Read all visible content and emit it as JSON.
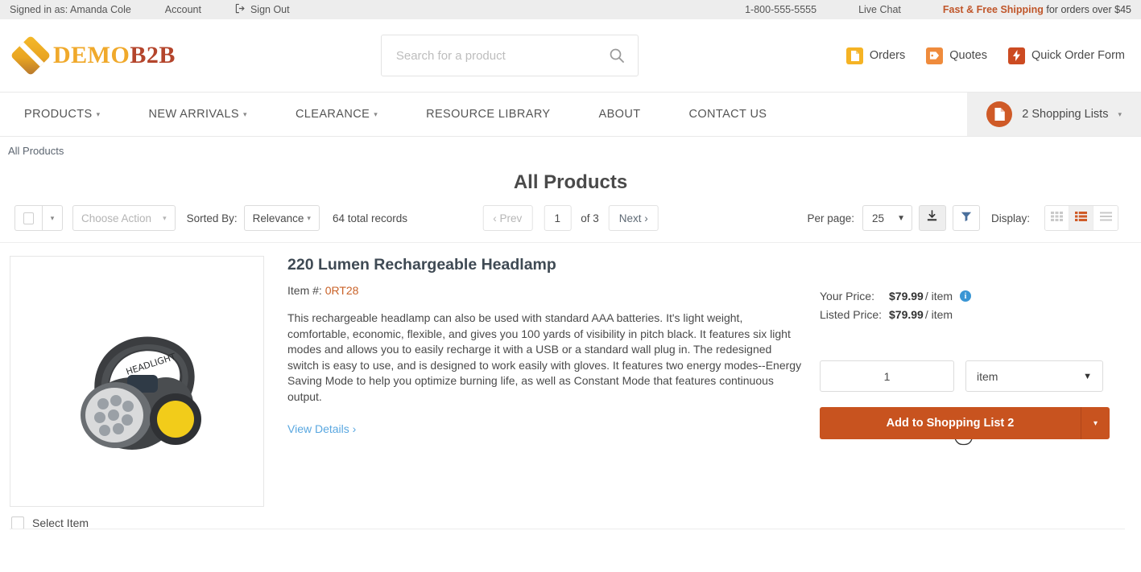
{
  "utility": {
    "signed_in": "Signed in as: Amanda Cole",
    "account": "Account",
    "sign_out": "Sign Out",
    "sign_out_icon": "sign-out-icon",
    "phone": "1-800-555-5555",
    "live_chat": "Live Chat",
    "shipping_highlight": "Fast & Free Shipping",
    "shipping_rest": " for orders over $45"
  },
  "header": {
    "logo_part1": "DEMO",
    "logo_part2": "B2B",
    "search_placeholder": "Search for a product",
    "search_value": "",
    "search_icon": "search-icon",
    "actions": [
      {
        "label": "Orders",
        "icon": "orders-document-icon",
        "color": "#f5b324"
      },
      {
        "label": "Quotes",
        "icon": "quotes-tag-icon",
        "color": "#ef8b3c"
      },
      {
        "label": "Quick Order Form",
        "icon": "lightning-bolt-icon",
        "color": "#cc4b22"
      }
    ]
  },
  "nav": {
    "items": [
      {
        "label": "PRODUCTS",
        "has_caret": true
      },
      {
        "label": "NEW ARRIVALS",
        "has_caret": true
      },
      {
        "label": "CLEARANCE",
        "has_caret": true
      },
      {
        "label": "RESOURCE LIBRARY",
        "has_caret": false
      },
      {
        "label": "ABOUT",
        "has_caret": false
      },
      {
        "label": "CONTACT US",
        "has_caret": false
      }
    ],
    "shopping_lists_label": "2 Shopping Lists",
    "shopping_lists_icon": "shopping-list-document-icon"
  },
  "breadcrumb": "All Products",
  "page_title": "All Products",
  "toolbar": {
    "select_all_caret": "▾",
    "choose_action": "Choose Action",
    "choose_action_caret": "▾",
    "sorted_by_label": "Sorted By:",
    "sort_value": "Relevance",
    "sort_caret": "▾",
    "total_records": "64 total records",
    "prev": "‹ Prev",
    "page_number": "1",
    "of_pages": "of 3",
    "next": "Next ›",
    "per_page_label": "Per page:",
    "per_page_value": "25",
    "per_page_caret": "▼",
    "export_icon": "download-export-icon",
    "filter_icon": "filter-funnel-icon",
    "display_label": "Display:",
    "view_modes": [
      {
        "name": "grid-view-icon",
        "active": false
      },
      {
        "name": "list-view-icon",
        "active": true
      },
      {
        "name": "detail-view-icon",
        "active": false
      }
    ],
    "accent_color": "#cf5a27"
  },
  "product": {
    "image_alt": "headlamp-product-photo",
    "select_item_label": "Select Item",
    "title": "220 Lumen Rechargeable Headlamp",
    "sku_label": "Item #:",
    "sku_value": "0RT28",
    "description": "This rechargeable headlamp can also be used with standard AAA batteries. It's light weight, comfortable, economic, flexible, and gives you 100 yards of visibility in pitch black. It features six light modes and allows you to easily recharge it with a USB or a standard wall plug in. The redesigned switch is easy to use, and is designed to work easily with gloves. It features two energy modes--Energy Saving Mode to help you optimize burning life, as well as Constant Mode that features continuous output.",
    "view_details": "View Details ›",
    "your_price_label": "Your Price:",
    "your_price_value": "$79.99",
    "your_price_unit": "/ item",
    "listed_price_label": "Listed Price:",
    "listed_price_value": "$79.99",
    "listed_price_unit": "/ item",
    "info_icon": "price-info-icon",
    "quantity_value": "1",
    "uom_value": "item",
    "uom_caret": "▼",
    "add_button_label": "Add to Shopping List 2",
    "add_button_caret": "▾",
    "add_button_color": "#c8531f"
  }
}
